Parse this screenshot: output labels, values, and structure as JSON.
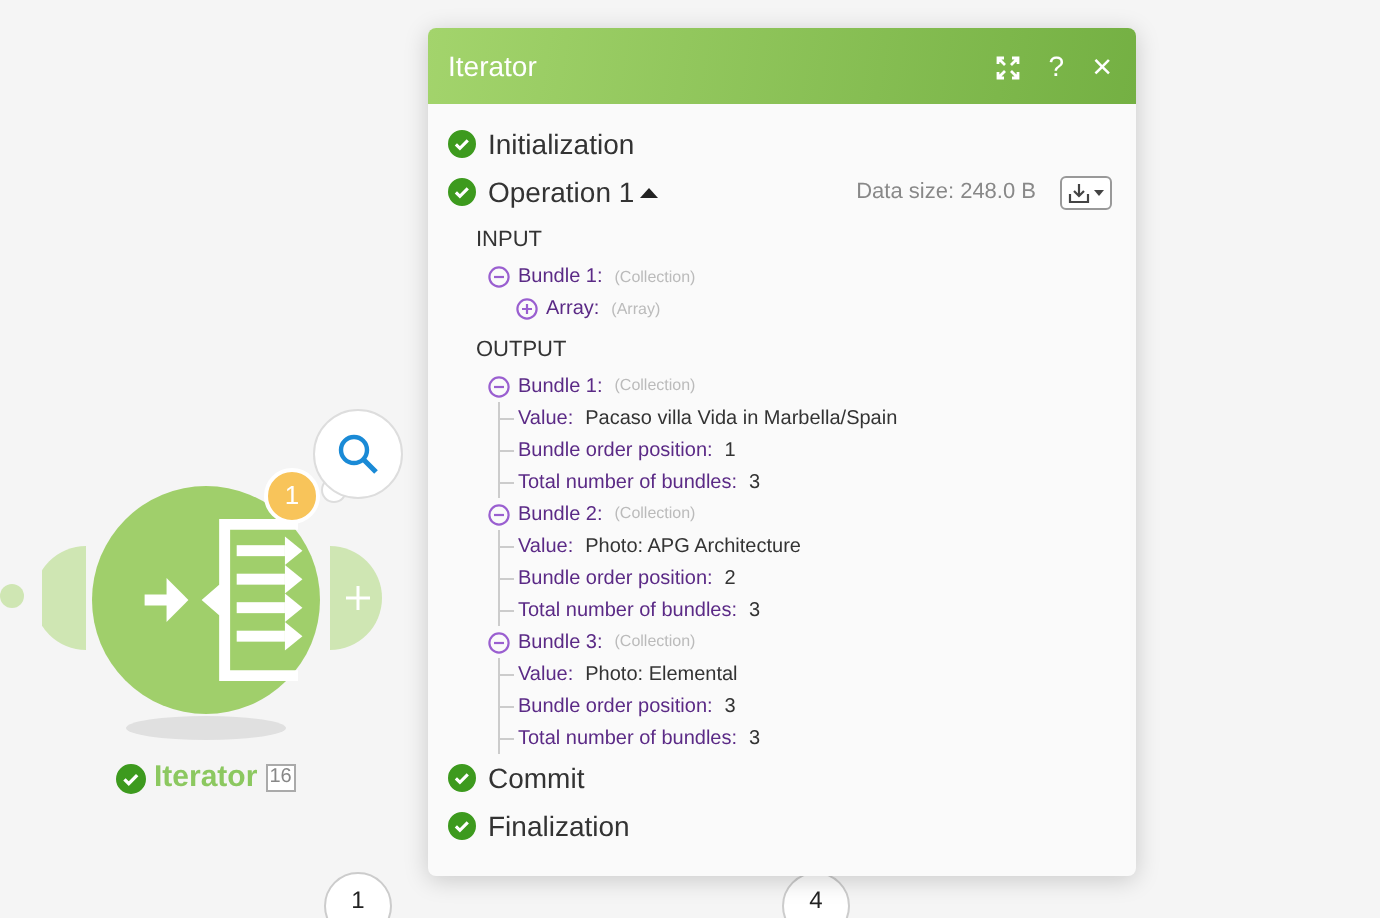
{
  "canvas": {
    "module": {
      "name": "Iterator",
      "done": true,
      "id_badge": "16",
      "operations_badge": "1"
    },
    "nodes": [
      {
        "label": "1"
      },
      {
        "label": "4"
      }
    ]
  },
  "panel": {
    "title": "Iterator",
    "help": "?",
    "close": "×",
    "items": [
      {
        "kind": "phase",
        "label": "Initialization",
        "done": true
      },
      {
        "kind": "operation",
        "label": "Operation 1",
        "done": true,
        "expanded": true,
        "data_size": "Data size: 248.0 B",
        "sections": [
          {
            "heading": "INPUT",
            "nodes": [
              {
                "label": "Bundle 1:",
                "type": "(Collection)",
                "expanded": true,
                "children": [
                  {
                    "label": "Array:",
                    "type": "(Array)",
                    "expanded": false
                  }
                ]
              }
            ]
          },
          {
            "heading": "OUTPUT",
            "nodes": [
              {
                "label": "Bundle 1:",
                "type": "(Collection)",
                "expanded": true,
                "children": [
                  {
                    "label": "Value:",
                    "value": "Pacaso villa Vida in Marbella/Spain"
                  },
                  {
                    "label": "Bundle order position:",
                    "value": "1"
                  },
                  {
                    "label": "Total number of bundles:",
                    "value": "3"
                  }
                ]
              },
              {
                "label": "Bundle 2:",
                "type": "(Collection)",
                "expanded": true,
                "children": [
                  {
                    "label": "Value:",
                    "value": "Photo: APG Architecture"
                  },
                  {
                    "label": "Bundle order position:",
                    "value": "2"
                  },
                  {
                    "label": "Total number of bundles:",
                    "value": "3"
                  }
                ]
              },
              {
                "label": "Bundle 3:",
                "type": "(Collection)",
                "expanded": true,
                "children": [
                  {
                    "label": "Value:",
                    "value": "Photo: Elemental"
                  },
                  {
                    "label": "Bundle order position:",
                    "value": "3"
                  },
                  {
                    "label": "Total number of bundles:",
                    "value": "3"
                  }
                ]
              }
            ]
          }
        ]
      },
      {
        "kind": "phase",
        "label": "Commit",
        "done": true
      },
      {
        "kind": "phase",
        "label": "Finalization",
        "done": true
      }
    ]
  }
}
